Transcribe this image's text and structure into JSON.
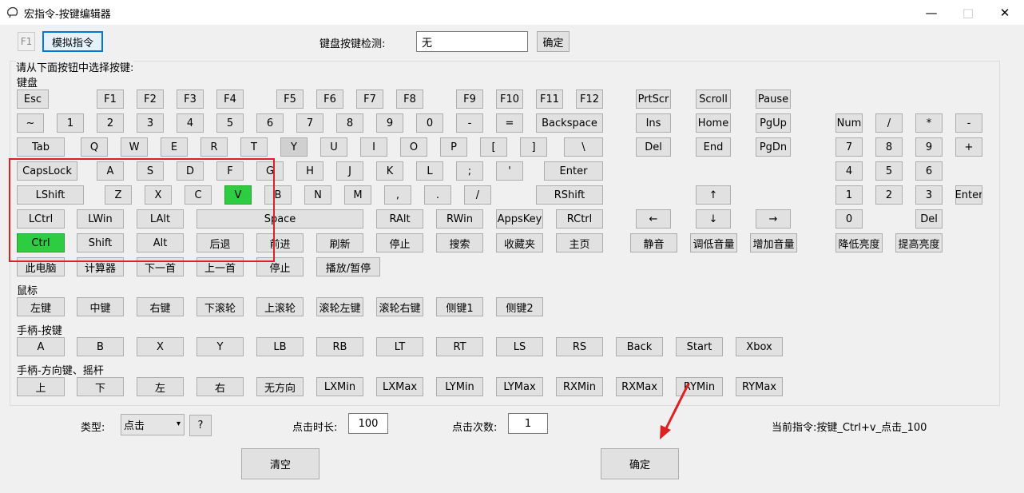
{
  "window": {
    "title": "宏指令-按键编辑器",
    "minimize": "—",
    "maximize": "□",
    "close": "✕"
  },
  "top": {
    "f1_label": "F1",
    "simulate_button": "模拟指令",
    "detect_label": "键盘按键检测:",
    "detect_value": "无",
    "confirm_button": "确定"
  },
  "group_title": "请从下面按钮中选择按键:",
  "sections": {
    "keyboard": "键盘",
    "mouse": "鼠标",
    "gamepad_buttons": "手柄-按键",
    "gamepad_dpad": "手柄-方向键、摇杆"
  },
  "keyboard_rows": [
    [
      "Esc",
      "F1",
      "F2",
      "F3",
      "F4",
      "F5",
      "F6",
      "F7",
      "F8",
      "F9",
      "F10",
      "F11",
      "F12",
      "PrtScr",
      "Scroll",
      "Pause"
    ],
    [
      "~",
      "1",
      "2",
      "3",
      "4",
      "5",
      "6",
      "7",
      "8",
      "9",
      "0",
      "-",
      "=",
      "Backspace",
      "Ins",
      "Home",
      "PgUp",
      "Num",
      "/",
      "*",
      "-"
    ],
    [
      "Tab",
      "Q",
      "W",
      "E",
      "R",
      "T",
      "Y",
      "U",
      "I",
      "O",
      "P",
      "[",
      "]",
      "\\",
      "Del",
      "End",
      "PgDn",
      "7",
      "8",
      "9",
      "+"
    ],
    [
      "CapsLock",
      "A",
      "S",
      "D",
      "F",
      "G",
      "H",
      "J",
      "K",
      "L",
      ";",
      "'",
      "Enter",
      "4",
      "5",
      "6"
    ],
    [
      "LShift",
      "Z",
      "X",
      "C",
      "V",
      "B",
      "N",
      "M",
      ",",
      ".",
      "/",
      "RShift",
      "↑",
      "1",
      "2",
      "3",
      "Enter"
    ],
    [
      "LCtrl",
      "LWin",
      "LAlt",
      "Space",
      "RAlt",
      "RWin",
      "AppsKey",
      "RCtrl",
      "←",
      "↓",
      "→",
      "0",
      "Del"
    ],
    [
      "Ctrl",
      "Shift",
      "Alt",
      "后退",
      "前进",
      "刷新",
      "停止",
      "搜索",
      "收藏夹",
      "主页",
      "静音",
      "调低音量",
      "增加音量",
      "降低亮度",
      "提高亮度"
    ],
    [
      "此电脑",
      "计算器",
      "下一首",
      "上一首",
      "停止",
      "播放/暂停"
    ]
  ],
  "mouse_keys": [
    "左键",
    "中键",
    "右键",
    "下滚轮",
    "上滚轮",
    "滚轮左键",
    "滚轮右键",
    "侧键1",
    "侧键2"
  ],
  "gamepad_keys": [
    "A",
    "B",
    "X",
    "Y",
    "LB",
    "RB",
    "LT",
    "RT",
    "LS",
    "RS",
    "Back",
    "Start",
    "Xbox"
  ],
  "gamepad_dpad_keys": [
    "上",
    "下",
    "左",
    "右",
    "无方向",
    "LXMin",
    "LXMax",
    "LYMin",
    "LYMax",
    "RXMin",
    "RXMax",
    "RYMin",
    "RYMax"
  ],
  "bottom": {
    "type_label": "类型:",
    "type_value": "点击",
    "help_button": "?",
    "duration_label": "点击时长:",
    "duration_value": "100",
    "count_label": "点击次数:",
    "count_value": "1",
    "current_label": "当前指令:按键_Ctrl+v_点击_100",
    "clear_button": "清空",
    "ok_button": "确定"
  },
  "colors": {
    "pressed": "#2ecc40",
    "annotation": "#e02020"
  }
}
